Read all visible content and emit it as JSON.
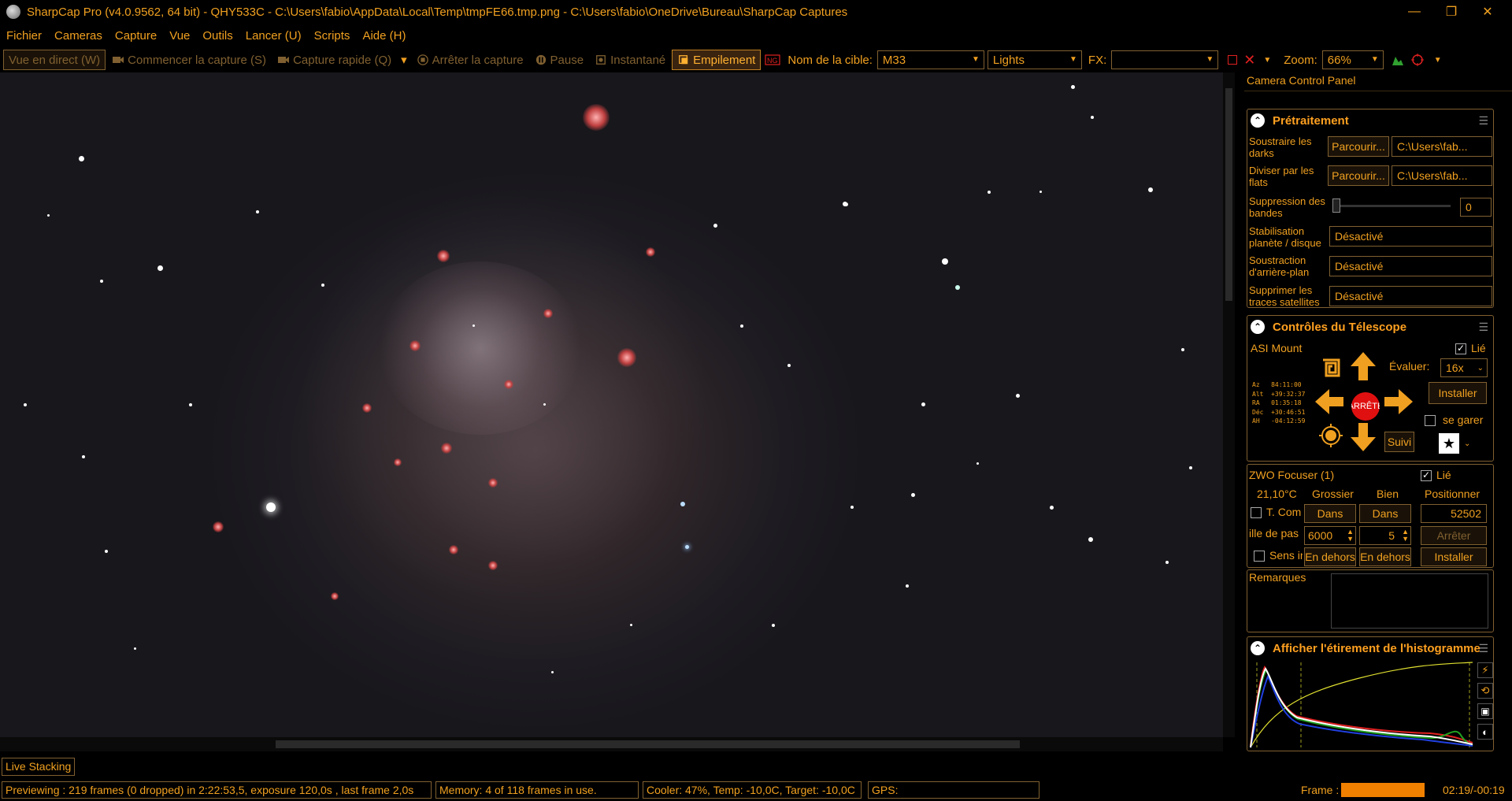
{
  "window": {
    "title": "SharpCap Pro (v4.0.9562, 64 bit) - QHY533C - C:\\Users\\fabio\\AppData\\Local\\Temp\\tmpFE66.tmp.png - C:\\Users\\fabio\\OneDrive\\Bureau\\SharpCap Captures",
    "minimize": "—",
    "restore": "❐",
    "close": "✕"
  },
  "menu": [
    "Fichier",
    "Cameras",
    "Capture",
    "Vue",
    "Outils",
    "Lancer (U)",
    "Scripts",
    "Aide (H)"
  ],
  "toolbar": {
    "live_view": "Vue en direct (W)",
    "start_capture": "Commencer la capture (S)",
    "quick_capture": "Capture rapide (Q)",
    "stop_capture": "Arrêter la capture",
    "pause": "Pause",
    "snapshot": "Instantané",
    "stacking": "Empilement",
    "target_label": "Nom de la cible:",
    "target_value": "M33",
    "frame_type": "Lights",
    "fx_label": "FX:",
    "fx_value": "",
    "zoom_label": "Zoom:",
    "zoom_value": "66%"
  },
  "panel": {
    "title": "Camera Control Panel",
    "preprocessing": {
      "header": "Prétraitement",
      "darks_label": "Soustraire les darks",
      "darks_browse": "Parcourir...",
      "darks_path": "C:\\Users\\fab...",
      "flats_label": "Diviser par les flats",
      "flats_browse": "Parcourir...",
      "flats_path": "C:\\Users\\fab...",
      "banding_label": "Suppression des bandes",
      "banding_value": "0",
      "stabilization_label": "Stabilisation planète / disque",
      "stabilization_value": "Désactivé",
      "background_label": "Soustraction d'arrière-plan",
      "background_value": "Désactivé",
      "satellite_label": "Supprimer les traces satellites",
      "satellite_value": "Désactivé"
    },
    "telescope": {
      "header": "Contrôles du Télescope",
      "mount_name": "ASI Mount",
      "linked_label": "Lié",
      "rate_label": "Évaluer:",
      "rate_value": "16x",
      "install_label": "Installer",
      "park_label": "se garer",
      "stop_label": "ARRÊTE",
      "track_label": "Suivi",
      "coords": [
        "Az   84:11:00",
        "Alt  +39:32:37",
        "RA   01:35:18",
        "Déc  +30:46:51",
        "AH   -04:12:59"
      ]
    },
    "focuser": {
      "name": "ZWO Focuser (1)",
      "linked_label": "Lié",
      "temperature": "21,10°C",
      "coarse_label": "Grossier",
      "fine_label": "Bien",
      "position_label": "Positionner",
      "tcomp_label": "T. Com",
      "in_label": "Dans",
      "position_value": "52502",
      "step_label": "ille de pas",
      "coarse_step": "6000",
      "fine_step": "5",
      "stop_label": "Arrêter",
      "reverse_label": "Sens ir",
      "out_label": "En dehors",
      "install_label": "Installer"
    },
    "notes_label": "Remarques",
    "histogram": {
      "header": "Afficher l'étirement de l'histogramme"
    }
  },
  "tabs": {
    "live_stacking": "Live Stacking"
  },
  "statusbar": {
    "preview": "Previewing : 219 frames (0 dropped) in 2:22:53,5, exposure 120,0s , last frame 2,0s",
    "memory": "Memory: 4 of 118 frames in use.",
    "cooler": "Cooler: 47%, Temp: -10,0C, Target: -10,0C",
    "gps": "GPS:",
    "frame_label": "Frame :",
    "frame_time": "02:19/-00:19",
    "frame_progress": 0.84
  },
  "colors": {
    "accent": "#f0a020",
    "border": "#806030",
    "stop_red": "#e01010"
  }
}
